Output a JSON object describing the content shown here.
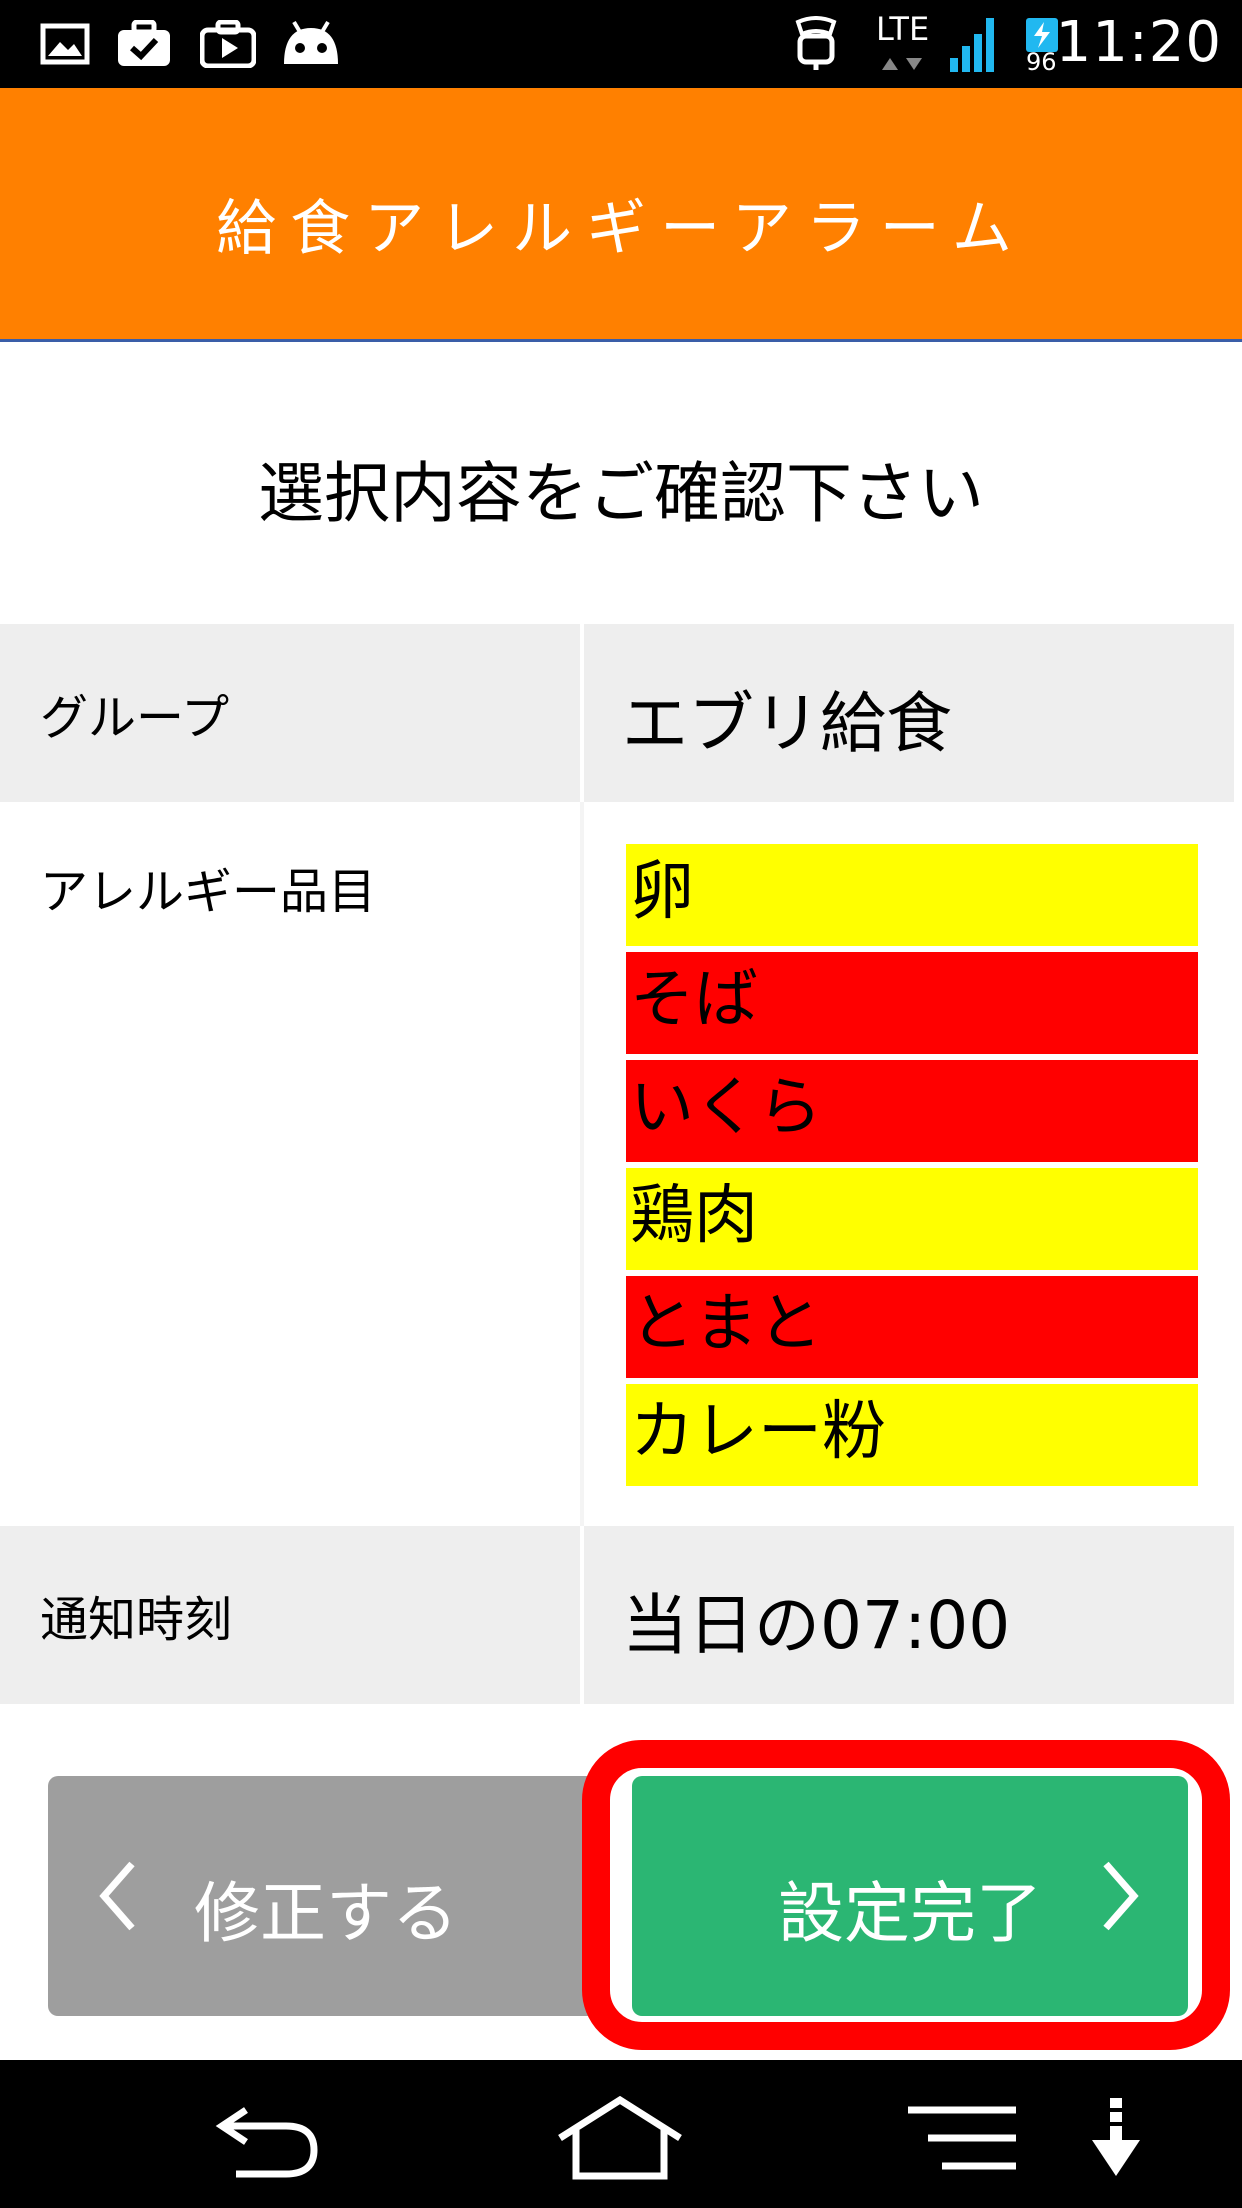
{
  "status_bar": {
    "time": "11:20",
    "network": "LTE",
    "battery": "96",
    "icons": [
      "image-icon",
      "briefcase-check-icon",
      "briefcase-play-icon",
      "android-icon",
      "alarm-icon",
      "signal-icon",
      "battery-charging-icon"
    ]
  },
  "header": {
    "title": "給食アレルギーアラーム"
  },
  "prompt": "選択内容をご確認下さい",
  "table": {
    "group_label": "グループ",
    "group_value": "エブリ給食",
    "allergen_label": "アレルギー品目",
    "allergens": [
      {
        "name": "卵",
        "color": "#ffff00"
      },
      {
        "name": "そば",
        "color": "#ff0000"
      },
      {
        "name": "いくら",
        "color": "#ff0000"
      },
      {
        "name": "鶏肉",
        "color": "#ffff00"
      },
      {
        "name": "とまと",
        "color": "#ff0000"
      },
      {
        "name": "カレー粉",
        "color": "#ffff00"
      }
    ],
    "notify_label": "通知時刻",
    "notify_value": "当日の07:00"
  },
  "buttons": {
    "back_label": "修正する",
    "done_label": "設定完了"
  },
  "colors": {
    "header": "#ff8000",
    "back_button": "#9e9e9e",
    "done_button": "#2bb673",
    "highlight": "#ff0000"
  },
  "nav_bar": {
    "icons": [
      "back-icon",
      "home-icon",
      "menu-icon",
      "download-icon"
    ]
  }
}
